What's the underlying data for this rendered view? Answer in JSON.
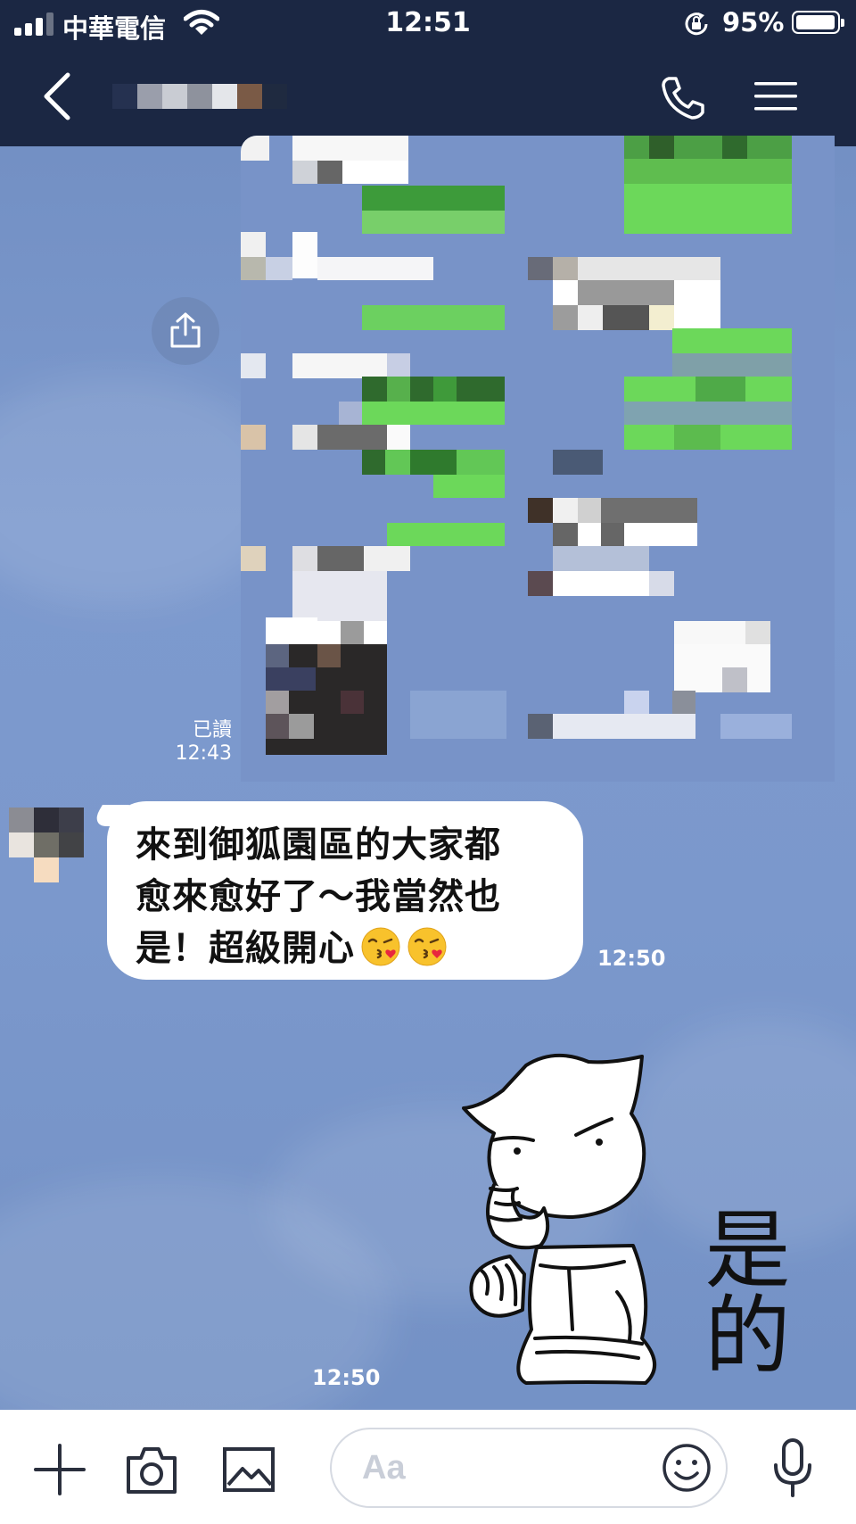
{
  "status_bar": {
    "carrier": "中華電信",
    "time": "12:51",
    "battery_percent": "95%"
  },
  "header": {
    "contact_name_redacted": true,
    "icons": [
      "back-icon",
      "call-icon",
      "menu-icon"
    ]
  },
  "messages": [
    {
      "type": "image",
      "direction": "outgoing",
      "read_label": "已讀",
      "time": "12:43",
      "redacted": true
    },
    {
      "type": "text",
      "direction": "incoming",
      "lines": [
        "來到御狐園區的大家都",
        "愈來愈好了～我當然也",
        "是！超級開心"
      ],
      "emoji": [
        "kissing-heart",
        "kissing-heart"
      ],
      "time": "12:50"
    },
    {
      "type": "sticker",
      "direction": "incoming",
      "sticker_text": "是的",
      "time": "12:50"
    }
  ],
  "input_bar": {
    "placeholder": "Aa",
    "icons": [
      "plus-icon",
      "camera-icon",
      "image-icon",
      "emoji-icon",
      "mic-icon"
    ]
  },
  "colors": {
    "header_bg": "#1b2743",
    "chat_bg": "#7b98cc",
    "bubble_bg": "#ffffff",
    "green_mosaic": "#6cd85a"
  }
}
